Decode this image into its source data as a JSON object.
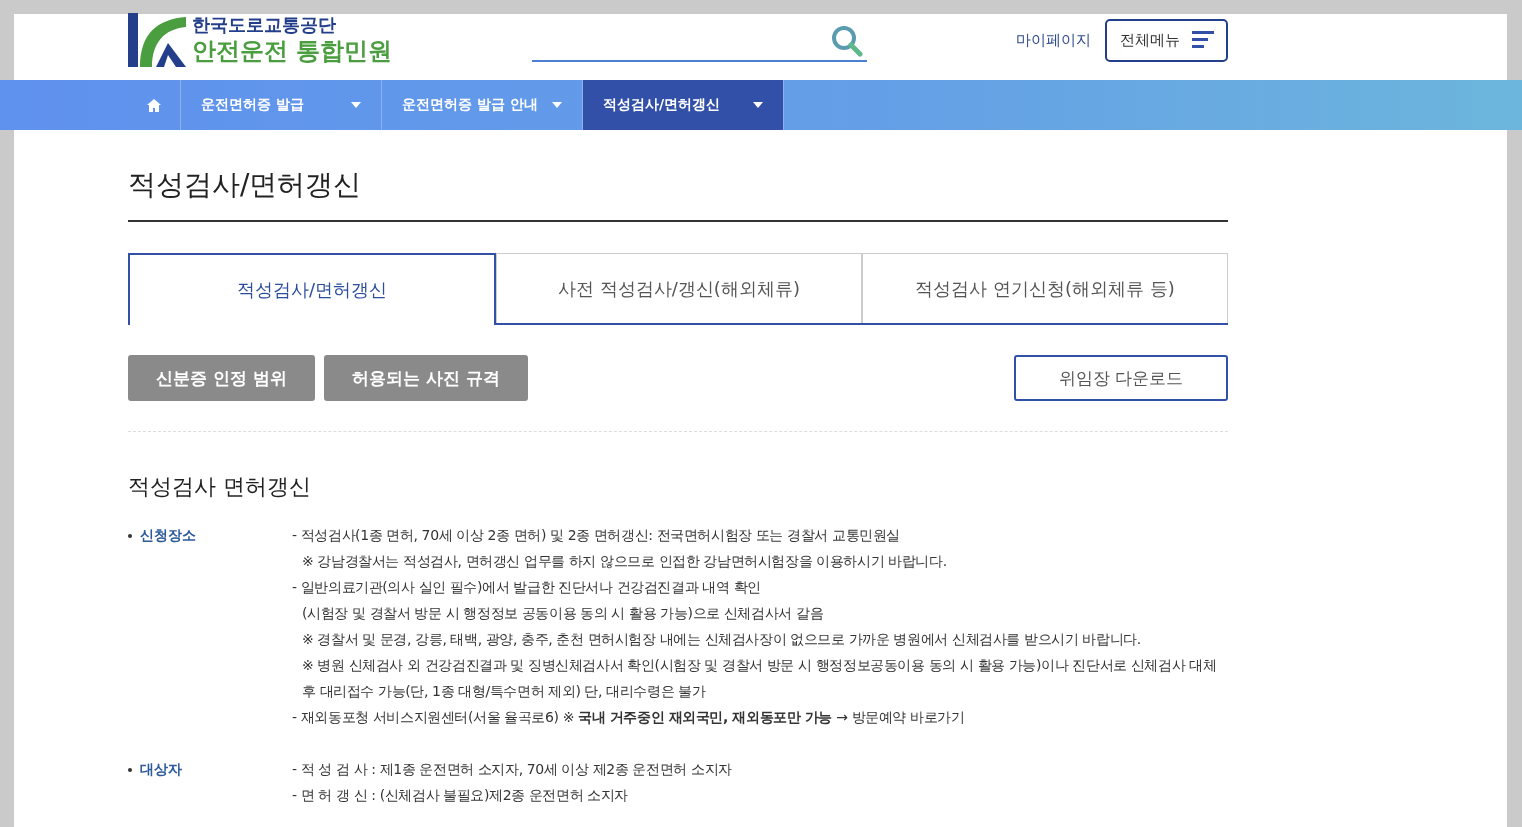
{
  "header": {
    "org": "한국도로교통공단",
    "service": "안전운전 통합민원",
    "mypage": "마이페이지",
    "menu_button": "전체메뉴"
  },
  "nav": [
    {
      "kind": "home",
      "selected": false
    },
    {
      "kind": "menu",
      "label": "운전면허증 발급",
      "selected": false
    },
    {
      "kind": "menu",
      "label": "운전면허증 발급 안내",
      "selected": false
    },
    {
      "kind": "menu",
      "label": "적성검사/면허갱신",
      "selected": true
    }
  ],
  "page_title": "적성검사/면허갱신",
  "tabs": [
    {
      "label": "적성검사/면허갱신",
      "selected": true
    },
    {
      "label": "사전 적성검사/갱신(해외체류)",
      "selected": false
    },
    {
      "label": "적성검사 연기신청(해외체류 등)",
      "selected": false
    }
  ],
  "buttons": [
    {
      "label": "신분증 인정 범위",
      "kind": "filled"
    },
    {
      "label": "허용되는 사진 규격",
      "kind": "filled"
    },
    {
      "label": "위임장 다운로드",
      "kind": "outline"
    }
  ],
  "section_title": "적성검사 면허갱신",
  "groups": [
    {
      "label": "신청장소",
      "lines": [
        {
          "kind": "item",
          "text": "- 적성검사(1종 면허, 70세 이상 2종 면허) 및 2종 면허갱신: 전국면허시험장 또는 경찰서 교통민원실"
        },
        {
          "kind": "sub",
          "text": "※ 강남경찰서는 적성검사, 면허갱신 업무를 하지 않으므로 인접한 강남면허시험장을 이용하시기 바랍니다."
        },
        {
          "kind": "item",
          "text": "- 일반의료기관(의사 실인 필수)에서 발급한 진단서나 건강검진결과 내역 확인"
        },
        {
          "kind": "sub",
          "text": "(시험장 및 경찰서 방문 시 행정정보 공동이용 동의 시 활용 가능)으로 신체검사서 갈음"
        },
        {
          "kind": "sub",
          "text": "※ 경찰서 및 문경, 강릉, 태백, 광양, 충주, 춘천 면허시험장 내에는 신체검사장이 없으므로 가까운 병원에서 신체검사를 받으시기 바랍니다."
        },
        {
          "kind": "sub",
          "text": "※ 병원 신체검사 외 건강검진결과 및 징병신체검사서 확인(시험장 및 경찰서 방문 시 행정정보공동이용 동의 시 활용 가능)이나 진단서로 신체검사 대체"
        },
        {
          "kind": "sub",
          "text": "후 대리접수 가능(단, 1종 대형/특수면허 제외) 단, 대리수령은 불가"
        },
        {
          "kind": "item",
          "text": "- 재외동포청 서비스지원센터(서울 율곡로6) ※ **국내 거주중인 재외국민, 재외동포만 가능** → 방문예약 바로가기"
        }
      ]
    },
    {
      "label": "대상자",
      "lines": [
        {
          "kind": "item",
          "text": "- 적 성 검 사 : 제1종 운전면허 소지자, 70세 이상 제2종 운전면허 소지자"
        },
        {
          "kind": "item",
          "text": "- 면 허 갱 신 : (신체검사 불필요)제2종 운전면허 소지자"
        }
      ]
    }
  ]
}
